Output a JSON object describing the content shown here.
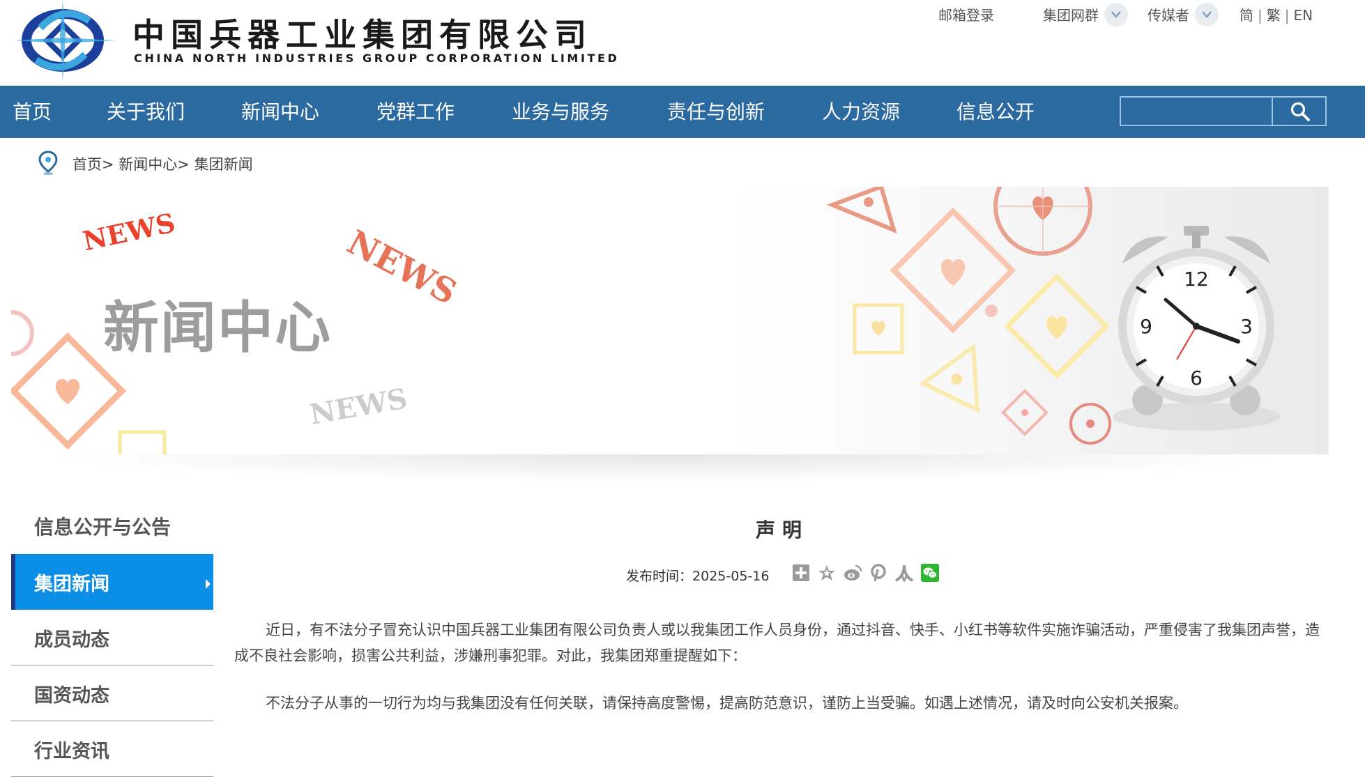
{
  "header": {
    "brand_cn": "中国兵器工业集团有限公司",
    "brand_en": "CHINA NORTH INDUSTRIES GROUP CORPORATION LIMITED",
    "top_links": {
      "mail_login": "邮箱登录",
      "group_sites": "集团网群",
      "media": "传媒者"
    },
    "languages": [
      "简",
      "繁",
      "EN"
    ],
    "brand_colors": {
      "logo_blue": "#1b3f9a",
      "logo_light": "#3ba6e0"
    }
  },
  "nav": {
    "items": [
      "首页",
      "关于我们",
      "新闻中心",
      "党群工作",
      "业务与服务",
      "责任与创新",
      "人力资源",
      "信息公开"
    ],
    "search_placeholder": "",
    "bg_color": "#2a6aa1"
  },
  "breadcrumb": {
    "items": [
      "首页",
      "新闻中心",
      "集团新闻"
    ],
    "separator": ">"
  },
  "banner": {
    "title": "新闻中心",
    "news_words": [
      "NEWS",
      "NEWS",
      "NEWS"
    ],
    "clock_numbers": [
      "12",
      "3",
      "6",
      "9"
    ]
  },
  "sidebar": {
    "heading": "信息公开与公告",
    "items": [
      {
        "label": "集团新闻",
        "active": true
      },
      {
        "label": "成员动态",
        "active": false
      },
      {
        "label": "国资动态",
        "active": false
      },
      {
        "label": "行业资讯",
        "active": false
      }
    ],
    "active_color": "#0b8ee6"
  },
  "article": {
    "title": "声明",
    "publish_label": "发布时间：",
    "publish_date": "2025-05-16",
    "share_icons": [
      "plus-share-icon",
      "favorite-star-icon",
      "weibo-icon",
      "pinterest-icon",
      "renren-icon",
      "wechat-icon"
    ],
    "paragraphs": [
      "近日，有不法分子冒充认识中国兵器工业集团有限公司负责人或以我集团工作人员身份，通过抖音、快手、小红书等软件实施诈骗活动，严重侵害了我集团声誉，造成不良社会影响，损害公共利益，涉嫌刑事犯罪。对此，我集团郑重提醒如下：",
      "不法分子从事的一切行为均与我集团没有任何关联，请保持高度警惕，提高防范意识，谨防上当受骗。如遇上述情况，请及时向公安机关报案。"
    ]
  }
}
